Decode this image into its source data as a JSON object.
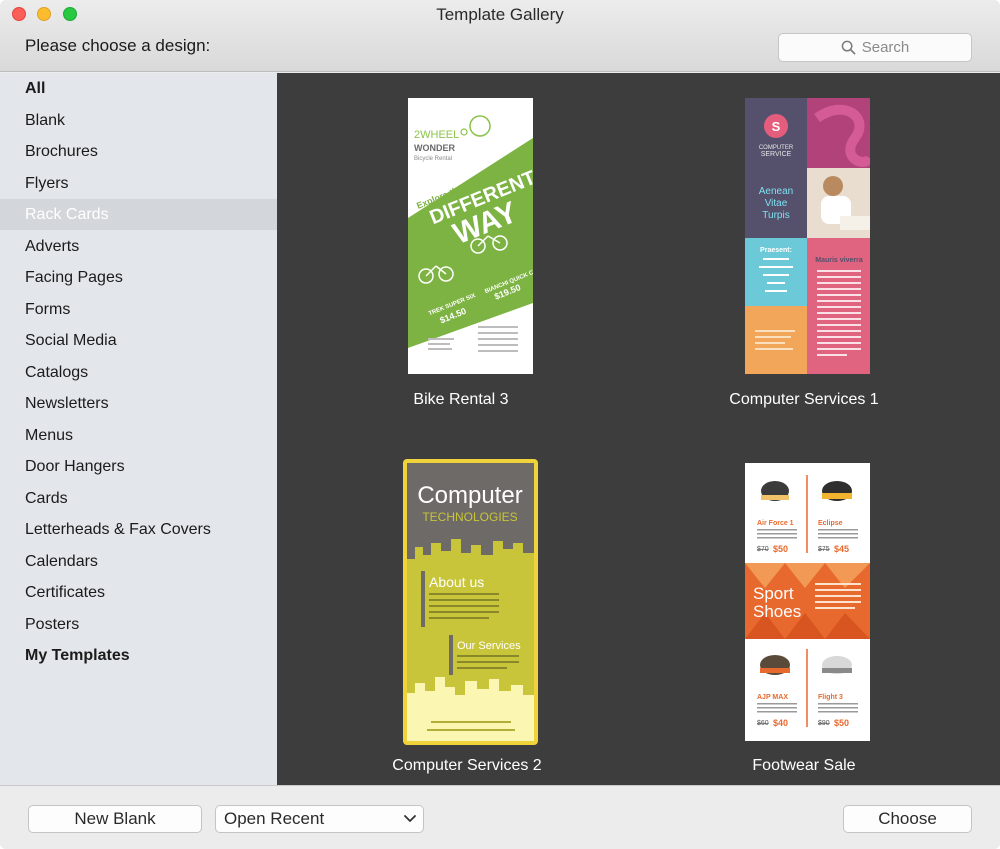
{
  "window": {
    "title": "Template Gallery"
  },
  "header": {
    "prompt": "Please choose a design:",
    "search_placeholder": "Search"
  },
  "sidebar": {
    "items": [
      {
        "label": "All",
        "bold": true
      },
      {
        "label": "Blank"
      },
      {
        "label": "Brochures"
      },
      {
        "label": "Flyers"
      },
      {
        "label": "Rack Cards",
        "selected": true
      },
      {
        "label": "Adverts"
      },
      {
        "label": "Facing Pages"
      },
      {
        "label": "Forms"
      },
      {
        "label": "Social Media"
      },
      {
        "label": "Catalogs"
      },
      {
        "label": "Newsletters"
      },
      {
        "label": "Menus"
      },
      {
        "label": "Door Hangers"
      },
      {
        "label": "Cards"
      },
      {
        "label": "Letterheads & Fax Covers"
      },
      {
        "label": "Calendars"
      },
      {
        "label": "Certificates"
      },
      {
        "label": "Posters"
      },
      {
        "label": "My Templates",
        "bold": true
      }
    ]
  },
  "templates": [
    {
      "name": "Bike Rental 3",
      "thumb": {
        "brand_line1": "2WHEEL",
        "brand_line2": "WONDER",
        "brand_line3": "Bicycle Rental",
        "headline1": "Explore the city in a",
        "headline2": "DIFFERENT",
        "headline3": "WAY",
        "item1": "TREK SUPER SIX",
        "item2": "BIANCHI QUICK CX",
        "price1": "$14.50",
        "price2": "$19.50"
      }
    },
    {
      "name": "Computer Services 1",
      "thumb": {
        "logo_letter": "S",
        "logo_text1": "COMPUTER",
        "logo_text2": "SERVICE",
        "block_text1": "Aenean",
        "block_text2": "Vitae",
        "block_text3": "Turpis",
        "side_title": "Praesent:",
        "pink_title": "Mauris viverra"
      }
    },
    {
      "name": "Computer Services 2",
      "selected": true,
      "thumb": {
        "title": "Computer",
        "subtitle": "TECHNOLOGIES",
        "section1": "About us",
        "section2": "Our Services"
      }
    },
    {
      "name": "Footwear Sale",
      "thumb": {
        "shoe1": "Air Force 1",
        "shoe2": "Eclipse",
        "shoe3": "AJP MAX",
        "shoe4": "Flight 3",
        "old1": "$70",
        "new1": "$50",
        "old2": "$75",
        "new2": "$45",
        "old3": "$60",
        "new3": "$40",
        "old4": "$90",
        "new4": "$50",
        "banner1": "Sport",
        "banner2": "Shoes"
      }
    }
  ],
  "footer": {
    "new_blank_label": "New Blank",
    "open_recent_label": "Open Recent",
    "choose_label": "Choose"
  },
  "colors": {
    "gallery_bg": "#3d3d3d",
    "selection_border": "#f0d23a",
    "bike_green": "#7cb342",
    "cs1_purple": "#55506b",
    "cs1_pink": "#e0637f",
    "cs1_cyan": "#6cc9d8",
    "cs1_orange": "#f2a65a",
    "cs2_yellow": "#c8c53a",
    "cs2_gray": "#6e6a67",
    "footwear_orange": "#e8692e"
  }
}
